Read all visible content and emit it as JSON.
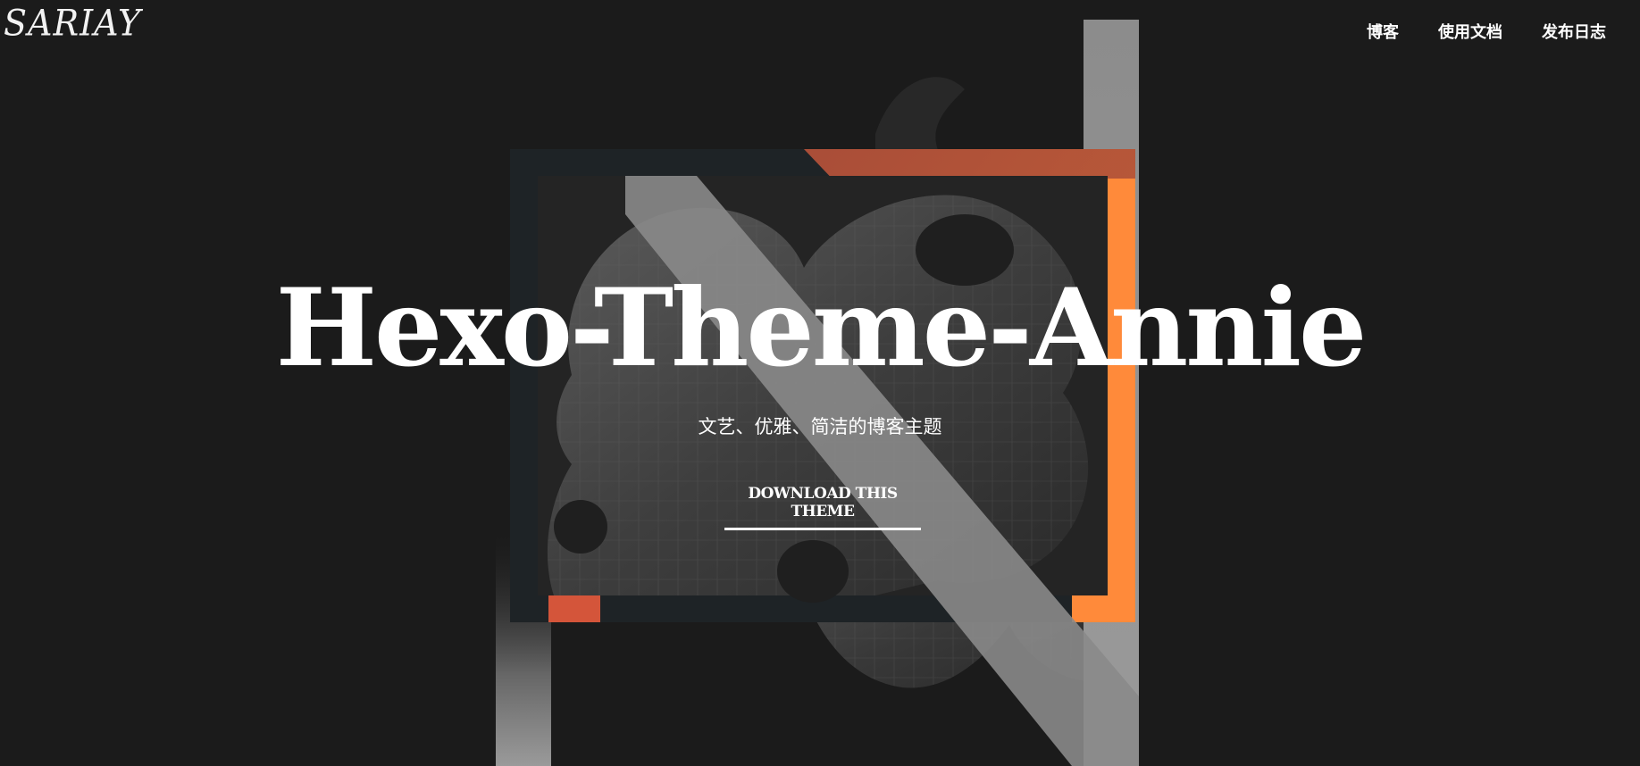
{
  "header": {
    "logo_text": "SARIAY",
    "nav": [
      {
        "label": "博客"
      },
      {
        "label": "使用文档"
      },
      {
        "label": "发布日志"
      }
    ]
  },
  "hero": {
    "title": "Hexo-Theme-Annie",
    "subtitle": "文艺、优雅、简洁的博客主题",
    "cta_label": "DOWNLOAD THIS THEME"
  },
  "colors": {
    "background": "#1b1b1b",
    "accent_orange": "#ff8a3a",
    "accent_red": "#d4553a",
    "frame_dark": "#1e2326",
    "stripe_gray": "#8a8a8a",
    "text": "#ffffff"
  },
  "icons": {
    "hero_artwork": "leaf-n-artwork"
  }
}
